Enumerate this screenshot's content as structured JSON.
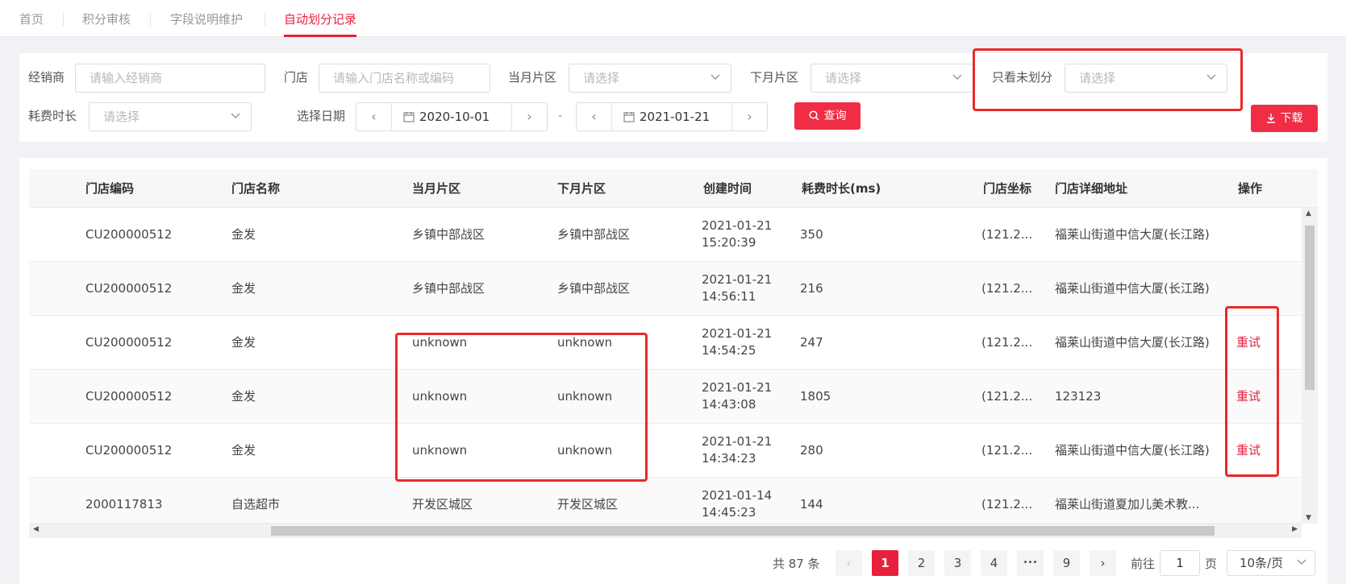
{
  "tabs": [
    {
      "label": "首页"
    },
    {
      "label": "积分审核"
    },
    {
      "label": "字段说明维护"
    },
    {
      "label": "自动划分记录"
    }
  ],
  "filters": {
    "dealer": {
      "label": "经销商",
      "placeholder": "请输入经销商"
    },
    "store": {
      "label": "门店",
      "placeholder": "请输入门店名称或编码"
    },
    "cur_area": {
      "label": "当月片区",
      "placeholder": "请选择"
    },
    "next_area": {
      "label": "下月片区",
      "placeholder": "请选择"
    },
    "unassigned": {
      "label": "只看未划分",
      "placeholder": "请选择"
    },
    "duration": {
      "label": "耗费时长",
      "placeholder": "请选择"
    },
    "date": {
      "label": "选择日期",
      "start": "2020-10-01",
      "end": "2021-01-21",
      "separator": "-"
    },
    "query_label": "查询",
    "download_label": "下载"
  },
  "table": {
    "columns": [
      "门店编码",
      "门店名称",
      "当月片区",
      "下月片区",
      "创建时间",
      "耗费时长(ms)",
      "门店坐标",
      "门店详细地址",
      "操作"
    ],
    "rows": [
      {
        "code": "CU200000512",
        "name": "金发",
        "cur": "乡镇中部战区",
        "next": "乡镇中部战区",
        "date": "2021-01-21",
        "time": "15:20:39",
        "dur": "350",
        "coord": "(121.2...",
        "addr": "福莱山街道中信大厦(长江路)",
        "op": ""
      },
      {
        "code": "CU200000512",
        "name": "金发",
        "cur": "乡镇中部战区",
        "next": "乡镇中部战区",
        "date": "2021-01-21",
        "time": "14:56:11",
        "dur": "216",
        "coord": "(121.2...",
        "addr": "福莱山街道中信大厦(长江路)",
        "op": ""
      },
      {
        "code": "CU200000512",
        "name": "金发",
        "cur": "unknown",
        "next": "unknown",
        "date": "2021-01-21",
        "time": "14:54:25",
        "dur": "247",
        "coord": "(121.2...",
        "addr": "福莱山街道中信大厦(长江路)",
        "op": "重试"
      },
      {
        "code": "CU200000512",
        "name": "金发",
        "cur": "unknown",
        "next": "unknown",
        "date": "2021-01-21",
        "time": "14:43:08",
        "dur": "1805",
        "coord": "(121.2...",
        "addr": "123123",
        "op": "重试"
      },
      {
        "code": "CU200000512",
        "name": "金发",
        "cur": "unknown",
        "next": "unknown",
        "date": "2021-01-21",
        "time": "14:34:23",
        "dur": "280",
        "coord": "(121.2...",
        "addr": "福莱山街道中信大厦(长江路)",
        "op": "重试"
      },
      {
        "code": "2000117813",
        "name": "自选超市",
        "cur": "开发区城区",
        "next": "开发区城区",
        "date": "2021-01-14",
        "time": "14:45:23",
        "dur": "144",
        "coord": "(121.2...",
        "addr": "福莱山街道夏加儿美术教...",
        "op": ""
      }
    ]
  },
  "pagination": {
    "total_text": "共 87 条",
    "pages": [
      "1",
      "2",
      "3",
      "4",
      "•••",
      "9"
    ],
    "current": "1",
    "goto_label": "前往",
    "goto_value": "1",
    "page_unit": "页",
    "page_size": "10条/页"
  },
  "colors": {
    "accent": "#e81f3d",
    "annotation": "#e82a2a"
  }
}
